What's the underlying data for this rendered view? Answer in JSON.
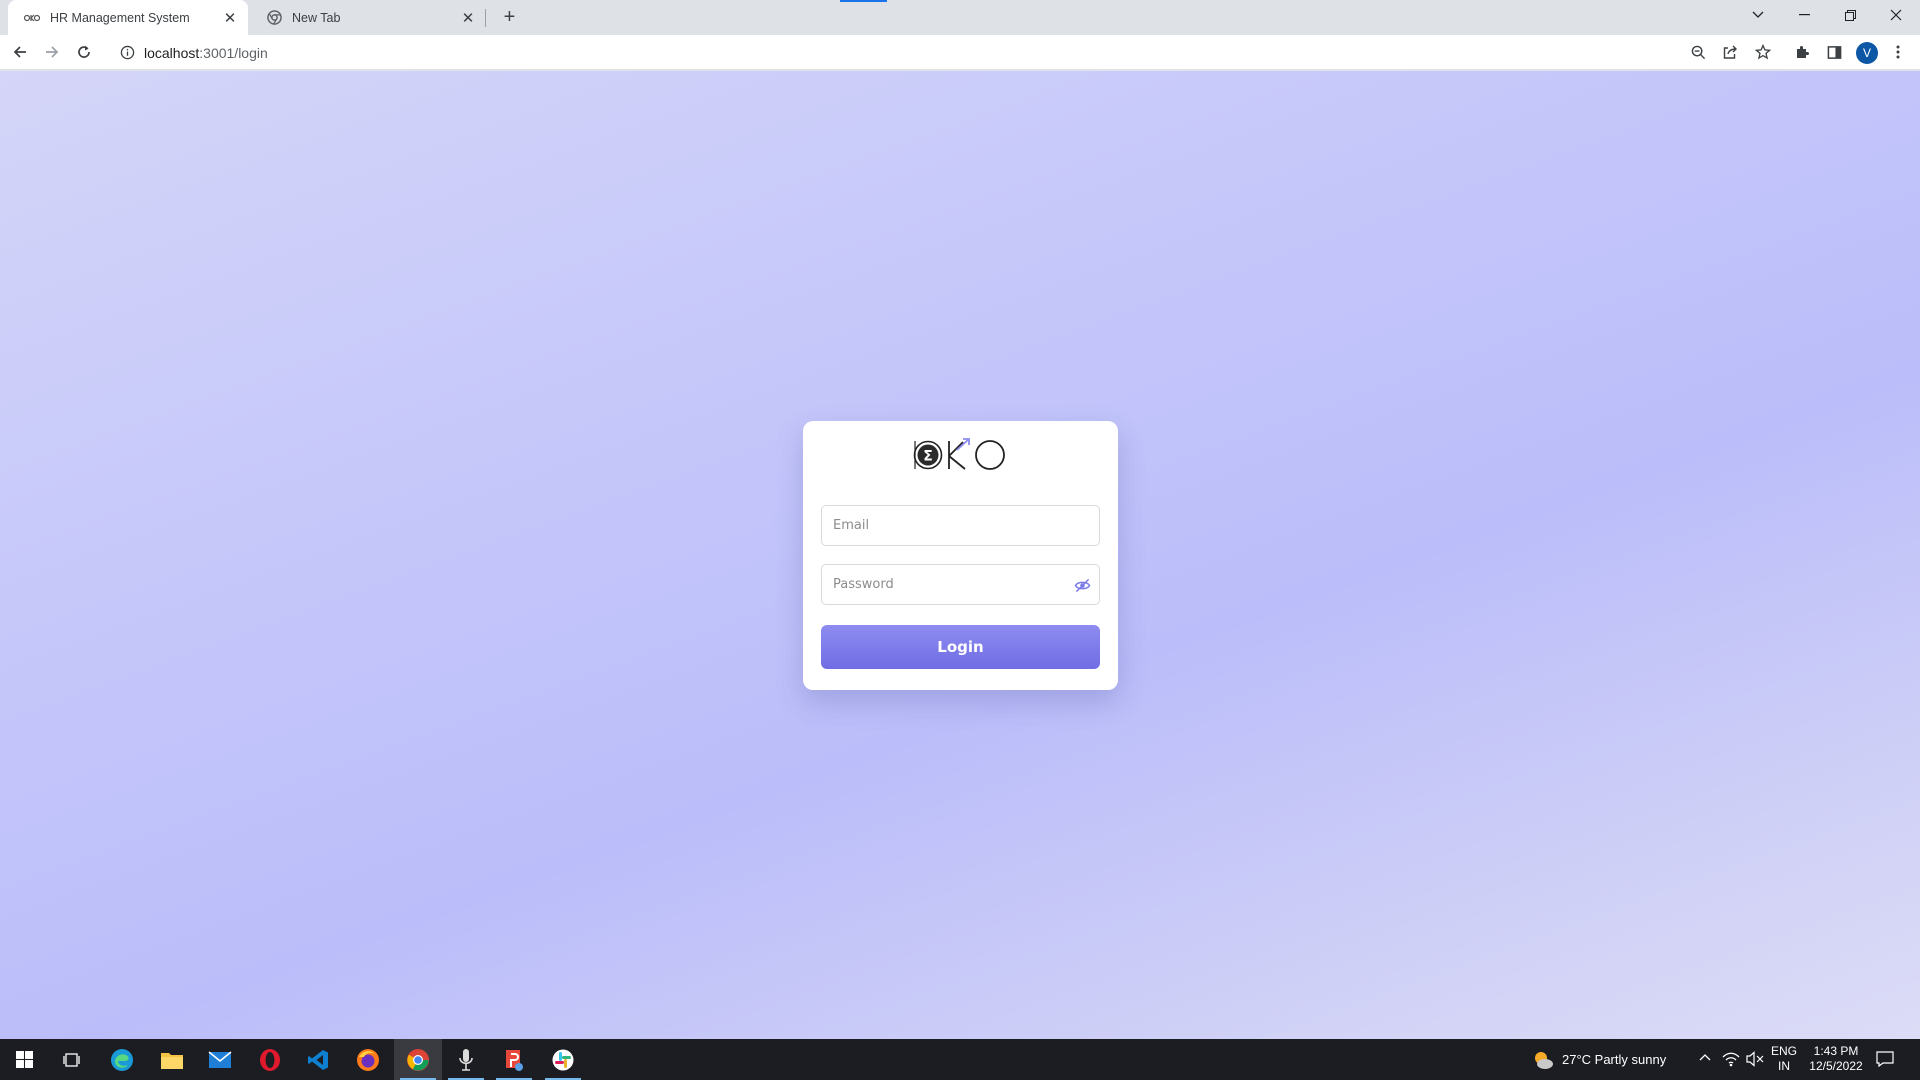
{
  "browser": {
    "tabs": [
      {
        "title": "HR Management System",
        "favicon": "oko-logo-icon",
        "active": true
      },
      {
        "title": "New Tab",
        "favicon": "chrome-icon",
        "active": false
      }
    ],
    "url_host": "localhost",
    "url_rest": ":3001/login",
    "profile_initial": "V"
  },
  "login": {
    "logo_text": "OKO",
    "email_placeholder": "Email",
    "password_placeholder": "Password",
    "login_label": "Login"
  },
  "colors": {
    "accent": "#7674e6",
    "page_gradient_top": "#c5c7fa",
    "taskbar": "#1c1d22"
  },
  "taskbar": {
    "apps": [
      "windows-start-icon",
      "task-view-icon",
      "edge-icon",
      "file-explorer-icon",
      "mail-icon",
      "opera-icon",
      "vscode-icon",
      "firefox-icon",
      "chrome-icon",
      "microphone-app-icon",
      "app-icon",
      "slack-icon"
    ],
    "weather": "27°C  Partly sunny",
    "language_line1": "ENG",
    "language_line2": "IN",
    "time": "1:43 PM",
    "date": "12/5/2022"
  }
}
